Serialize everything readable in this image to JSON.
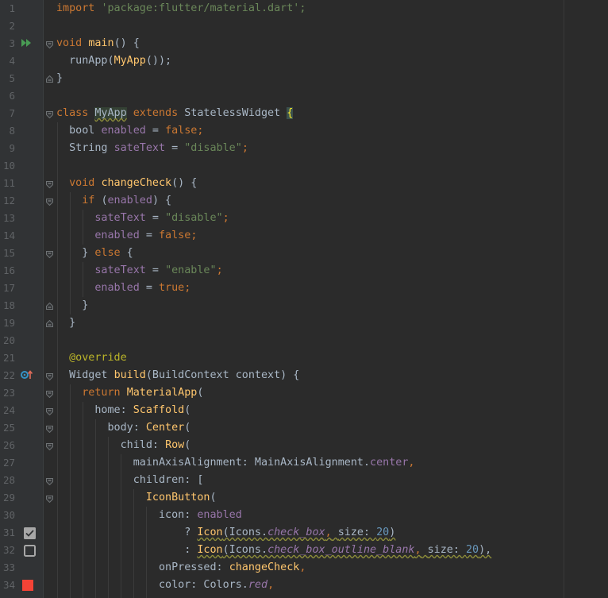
{
  "editor": {
    "colors": {
      "background": "#2b2b2b",
      "gutter": "#313335",
      "line_number": "#606366",
      "keyword": "#cc7832",
      "string": "#6a8759",
      "function": "#ffc66d",
      "field": "#9876aa",
      "default_text": "#a9b7c6",
      "annotation": "#bbb529"
    },
    "line_numbers": [
      "1",
      "2",
      "3",
      "4",
      "5",
      "6",
      "7",
      "8",
      "9",
      "10",
      "11",
      "12",
      "13",
      "14",
      "15",
      "16",
      "17",
      "18",
      "19",
      "20",
      "21",
      "22",
      "23",
      "24",
      "25",
      "26",
      "27",
      "28",
      "29",
      "30",
      "31",
      "32",
      "33",
      "34"
    ],
    "gutter_icons": {
      "run": "run-main-icon",
      "override": "override-method-icon",
      "checkbox_checked": "check-box-icon",
      "checkbox_blank": "check-box-outline-blank-icon",
      "color_swatch": "red-color-swatch-icon"
    },
    "tokens": {
      "import": "import",
      "import_path": "'package:flutter/material.dart';",
      "void": "void",
      "main": "main",
      "main_sig": "() {",
      "runApp": "runApp(",
      "myapp_call": "MyApp",
      "runApp_end": "());",
      "close_brace": "}",
      "class": "class",
      "myapp": "MyApp",
      "extends": "extends",
      "stateless": "StatelessWidget",
      "open_brace": "{",
      "bool": "bool",
      "enabled": "enabled",
      "eq": " = ",
      "false": "false",
      "true": "true",
      "semi": ";",
      "string_type": "String",
      "sateText": "sateText",
      "str_disable": "\"disable\"",
      "str_enable": "\"enable\"",
      "changeCheck": "changeCheck",
      "paren_open_brace": "() {",
      "if": "if",
      "if_cond_open": "(",
      "if_cond_close": ") {",
      "else_open": "} ",
      "else": "else",
      "else_brace": " {",
      "override": "@override",
      "widget": "Widget",
      "build": "build",
      "build_params": "(BuildContext context) {",
      "return": "return",
      "materialApp": "MaterialApp",
      "paren": "(",
      "home": "home: ",
      "scaffold": "Scaffold",
      "body": "body: ",
      "center": "Center",
      "child": "child: ",
      "row": "Row",
      "mainAxis": "mainAxisAlignment: MainAxisAlignment.",
      "center_field": "center",
      "comma": ",",
      "children": "children: [",
      "iconButton": "IconButton",
      "icon_label": "icon: ",
      "q": "? ",
      "colon": ": ",
      "icon": "Icon",
      "icons_prefix": "(Icons.",
      "check_box": "check_box",
      "check_box_outline_blank": "check_box_outline_blank",
      "size_label": "size: ",
      "size_val": "20",
      "close_paren": ")",
      "close_paren_comma": "),",
      "onPressed": "onPressed: ",
      "color_label": "color: Colors.",
      "red": "red"
    }
  }
}
